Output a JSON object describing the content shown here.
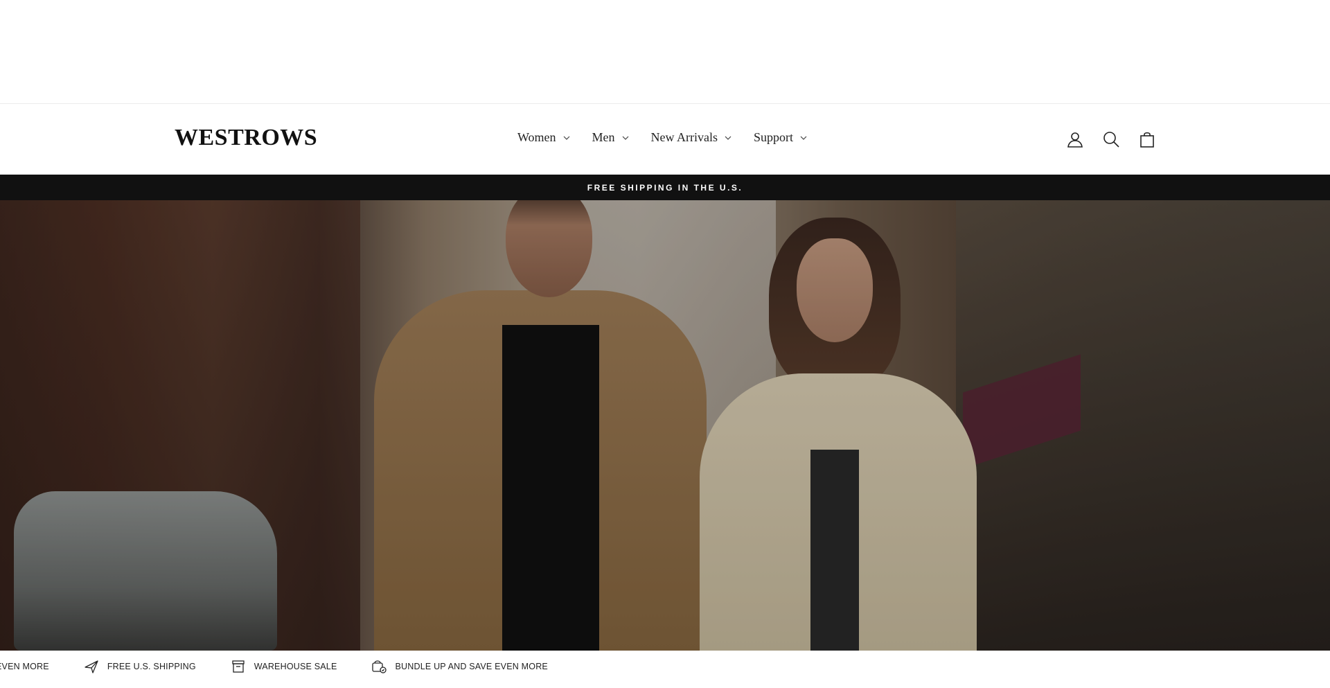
{
  "brand": {
    "logo": "WESTROWS"
  },
  "nav": {
    "items": [
      {
        "label": "Women"
      },
      {
        "label": "Men"
      },
      {
        "label": "New Arrivals"
      },
      {
        "label": "Support"
      }
    ]
  },
  "header_icons": [
    "account-icon",
    "search-icon",
    "cart-icon"
  ],
  "announcement": {
    "text": "FREE SHIPPING IN THE U.S."
  },
  "ticker": {
    "items": [
      {
        "text": "EVEN MORE",
        "icon": ""
      },
      {
        "text": "FREE U.S. SHIPPING",
        "icon": "plane-icon"
      },
      {
        "text": "WAREHOUSE SALE",
        "icon": "box-icon"
      },
      {
        "text": "BUNDLE UP AND SAVE EVEN MORE",
        "icon": "bundle-icon"
      }
    ]
  },
  "colors": {
    "announcement_bg": "#111111",
    "text": "#222222"
  }
}
